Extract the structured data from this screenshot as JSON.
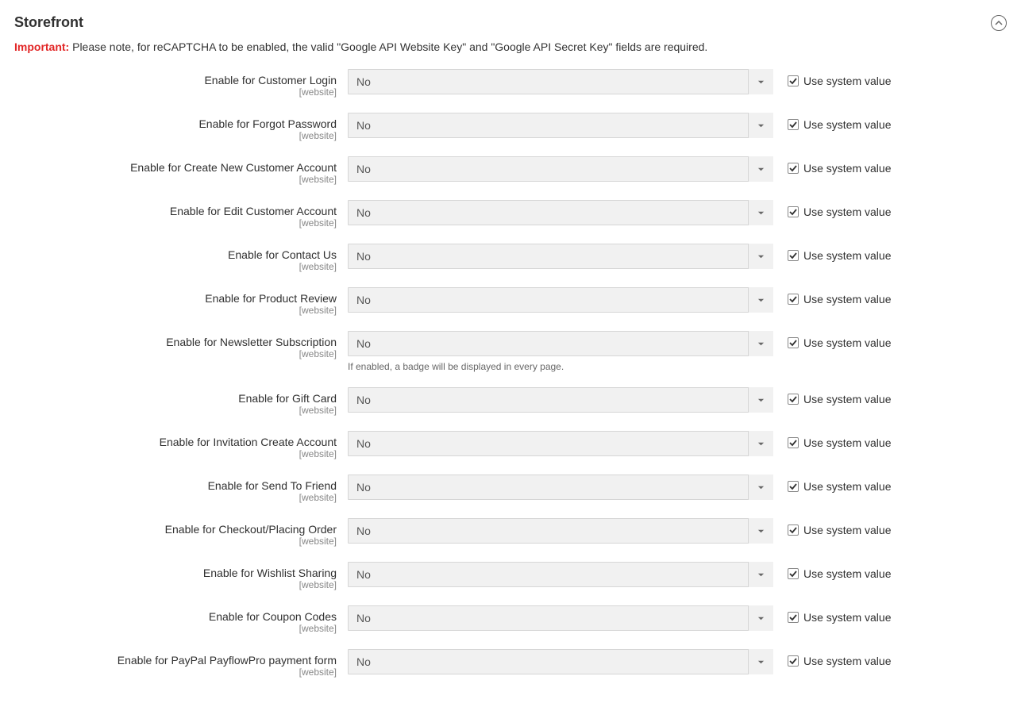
{
  "section": {
    "title": "Storefront"
  },
  "note": {
    "label": "Important:",
    "text": "Please note, for reCAPTCHA to be enabled, the valid \"Google API Website Key\" and \"Google API Secret Key\" fields are required."
  },
  "common": {
    "scope": "[website]",
    "use_system": "Use system value",
    "no": "No"
  },
  "fields": {
    "customer_login": {
      "label": "Enable for Customer Login"
    },
    "forgot_password": {
      "label": "Enable for Forgot Password"
    },
    "create_customer": {
      "label": "Enable for Create New Customer Account"
    },
    "edit_customer": {
      "label": "Enable for Edit Customer Account"
    },
    "contact_us": {
      "label": "Enable for Contact Us"
    },
    "product_review": {
      "label": "Enable for Product Review"
    },
    "newsletter": {
      "label": "Enable for Newsletter Subscription",
      "note": "If enabled, a badge will be displayed in every page."
    },
    "gift_card": {
      "label": "Enable for Gift Card"
    },
    "invitation": {
      "label": "Enable for Invitation Create Account"
    },
    "send_friend": {
      "label": "Enable for Send To Friend"
    },
    "checkout": {
      "label": "Enable for Checkout/Placing Order"
    },
    "wishlist": {
      "label": "Enable for Wishlist Sharing"
    },
    "coupon": {
      "label": "Enable for Coupon Codes"
    },
    "paypal": {
      "label": "Enable for PayPal PayflowPro payment form"
    }
  }
}
